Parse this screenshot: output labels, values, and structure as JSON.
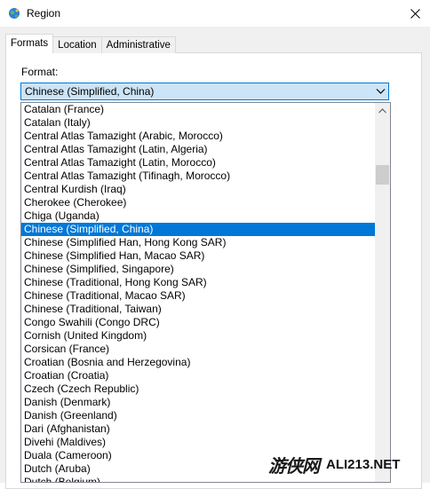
{
  "window": {
    "title": "Region"
  },
  "tabs": [
    {
      "label": "Formats",
      "active": true
    },
    {
      "label": "Location",
      "active": false
    },
    {
      "label": "Administrative",
      "active": false
    }
  ],
  "formats": {
    "format_label": "Format:",
    "selected_value": "Chinese (Simplified, China)",
    "options": [
      "Catalan (France)",
      "Catalan (Italy)",
      "Central Atlas Tamazight (Arabic, Morocco)",
      "Central Atlas Tamazight (Latin, Algeria)",
      "Central Atlas Tamazight (Latin, Morocco)",
      "Central Atlas Tamazight (Tifinagh, Morocco)",
      "Central Kurdish (Iraq)",
      "Cherokee (Cherokee)",
      "Chiga (Uganda)",
      "Chinese (Simplified, China)",
      "Chinese (Simplified Han, Hong Kong SAR)",
      "Chinese (Simplified Han, Macao SAR)",
      "Chinese (Simplified, Singapore)",
      "Chinese (Traditional, Hong Kong SAR)",
      "Chinese (Traditional, Macao SAR)",
      "Chinese (Traditional, Taiwan)",
      "Congo Swahili (Congo DRC)",
      "Cornish (United Kingdom)",
      "Corsican (France)",
      "Croatian (Bosnia and Herzegovina)",
      "Croatian (Croatia)",
      "Czech (Czech Republic)",
      "Danish (Denmark)",
      "Danish (Greenland)",
      "Dari (Afghanistan)",
      "Divehi (Maldives)",
      "Duala (Cameroon)",
      "Dutch (Aruba)",
      "Dutch (Belgium)"
    ],
    "selected_index": 9
  },
  "watermark": {
    "cn": "游侠网",
    "en": "ALI213.NET"
  },
  "colors": {
    "accent": "#0078d7",
    "combo_bg": "#cce4f7",
    "dialog_bg": "#f0f0f0"
  }
}
